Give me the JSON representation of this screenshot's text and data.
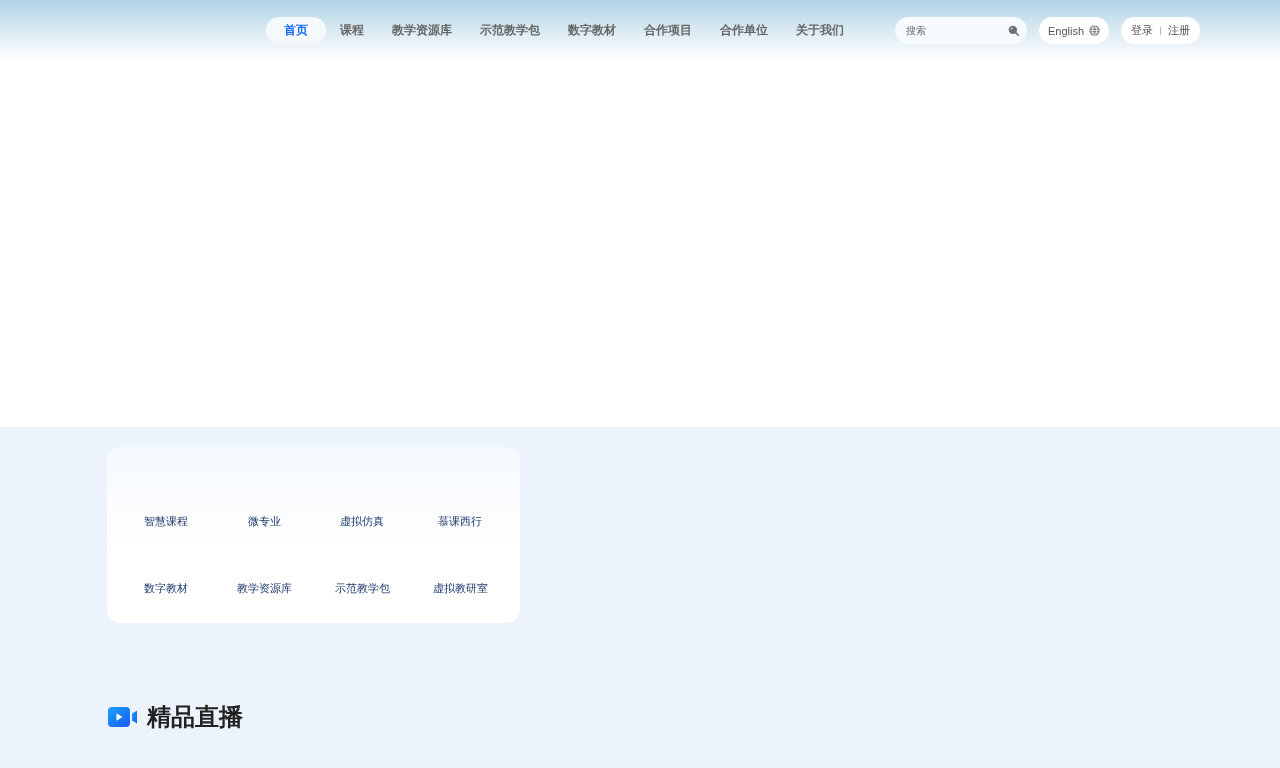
{
  "header": {
    "nav_tabs": [
      {
        "label": "首页",
        "selected": true
      },
      {
        "label": "课程",
        "selected": false
      },
      {
        "label": "教学资源库",
        "selected": false
      },
      {
        "label": "示范教学包",
        "selected": false
      },
      {
        "label": "数字教材",
        "selected": false
      },
      {
        "label": "合作项目",
        "selected": false
      },
      {
        "label": "合作单位",
        "selected": false
      },
      {
        "label": "关于我们",
        "selected": false
      }
    ],
    "search": {
      "placeholder": "搜索"
    },
    "language_button": {
      "label": "English"
    },
    "auth": {
      "login": "登录",
      "register": "注册"
    }
  },
  "quick_links": [
    "智慧课程",
    "微专业",
    "虚拟仿真",
    "慕课西行",
    "数字教材",
    "教学资源库",
    "示范教学包",
    "虚拟教研室"
  ],
  "live_section": {
    "title": "精品直播"
  }
}
